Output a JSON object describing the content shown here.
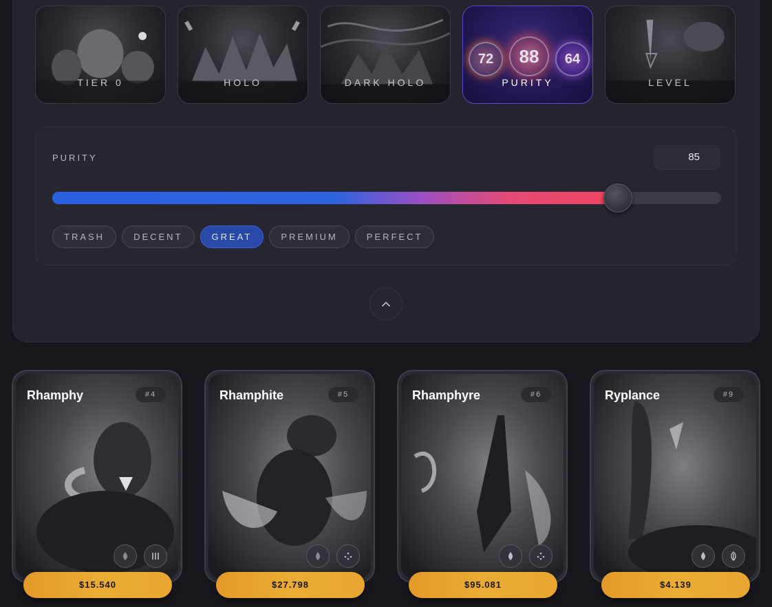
{
  "filters": [
    {
      "label": "TIER 0",
      "active": false
    },
    {
      "label": "HOLO",
      "active": false
    },
    {
      "label": "DARK HOLO",
      "active": false
    },
    {
      "label": "PURITY",
      "active": true,
      "bubbles": [
        "72",
        "88",
        "64"
      ]
    },
    {
      "label": "LEVEL",
      "active": false
    }
  ],
  "purity": {
    "title": "PURITY",
    "value": "85",
    "fraction": 0.835,
    "tiers": [
      {
        "label": "TRASH",
        "active": false
      },
      {
        "label": "DECENT",
        "active": false
      },
      {
        "label": "GREAT",
        "active": true
      },
      {
        "label": "PREMIUM",
        "active": false
      },
      {
        "label": "PERFECT",
        "active": false
      }
    ]
  },
  "collapse_icon": "chevron-up-icon",
  "cards": [
    {
      "name": "Rhamphy",
      "number": "#4",
      "price": "$15.540",
      "icons": [
        "fire-icon",
        "claw-icon"
      ]
    },
    {
      "name": "Rhamphite",
      "number": "#5",
      "price": "$27.798",
      "icons": [
        "fire-icon",
        "spark-icon"
      ]
    },
    {
      "name": "Rhamphyre",
      "number": "#6",
      "price": "$95.081",
      "icons": [
        "fire-icon",
        "spark-icon"
      ]
    },
    {
      "name": "Ryplance",
      "number": "#9",
      "price": "$4.139",
      "icons": [
        "drop-icon",
        "leaf-icon"
      ]
    }
  ],
  "colors": {
    "accent_blue": "#2c5fe0",
    "accent_pink": "#f04460",
    "price_gold": "#e9ac32",
    "active_tier": "#2849a8"
  }
}
